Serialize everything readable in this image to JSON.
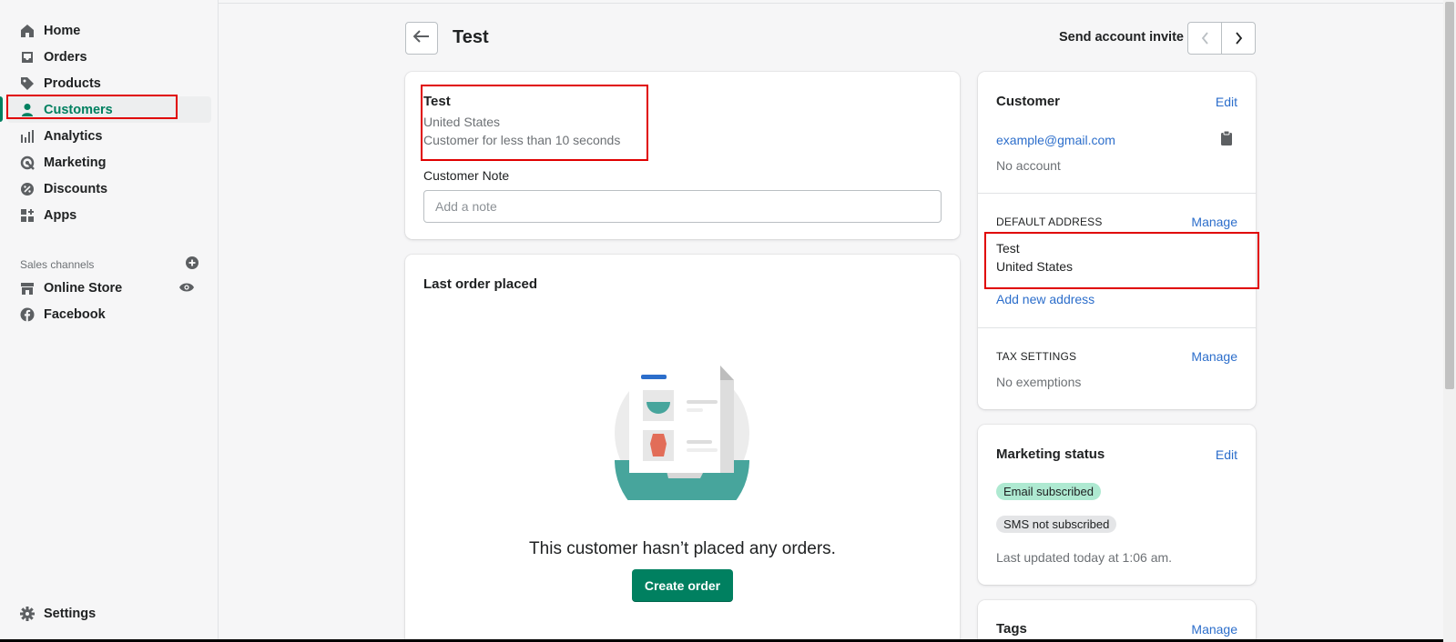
{
  "sidebar": {
    "items": [
      {
        "label": "Home",
        "icon": "home-icon"
      },
      {
        "label": "Orders",
        "icon": "inbox-icon"
      },
      {
        "label": "Products",
        "icon": "tag-icon"
      },
      {
        "label": "Customers",
        "icon": "person-icon"
      },
      {
        "label": "Analytics",
        "icon": "bar-chart-icon"
      },
      {
        "label": "Marketing",
        "icon": "target-icon"
      },
      {
        "label": "Discounts",
        "icon": "discount-icon"
      },
      {
        "label": "Apps",
        "icon": "apps-icon"
      }
    ],
    "sales_channels_heading": "Sales channels",
    "channels": [
      {
        "label": "Online Store",
        "icon": "store-icon"
      },
      {
        "label": "Facebook",
        "icon": "facebook-icon"
      }
    ],
    "settings_label": "Settings",
    "active_color": "#008060"
  },
  "header": {
    "title": "Test",
    "send_invite": "Send account invite"
  },
  "customer_card": {
    "name": "Test",
    "country": "United States",
    "since": "Customer for less than 10 seconds",
    "note_label": "Customer Note",
    "note_placeholder": "Add a note"
  },
  "orders_card": {
    "title": "Last order placed",
    "empty_text": "This customer hasn’t placed any orders.",
    "create_button": "Create order"
  },
  "contact_card": {
    "title": "Customer",
    "edit": "Edit",
    "email": "example@gmail.com",
    "account_status": "No account",
    "default_address_heading": "DEFAULT ADDRESS",
    "manage": "Manage",
    "address_name": "Test",
    "address_country": "United States",
    "add_address": "Add new address",
    "tax_heading": "TAX SETTINGS",
    "tax_manage": "Manage",
    "tax_value": "No exemptions"
  },
  "marketing_card": {
    "title": "Marketing status",
    "edit": "Edit",
    "email_badge": "Email subscribed",
    "sms_badge": "SMS not subscribed",
    "updated": "Last updated today at 1:06 am."
  },
  "tags_card": {
    "title": "Tags",
    "manage": "Manage"
  }
}
